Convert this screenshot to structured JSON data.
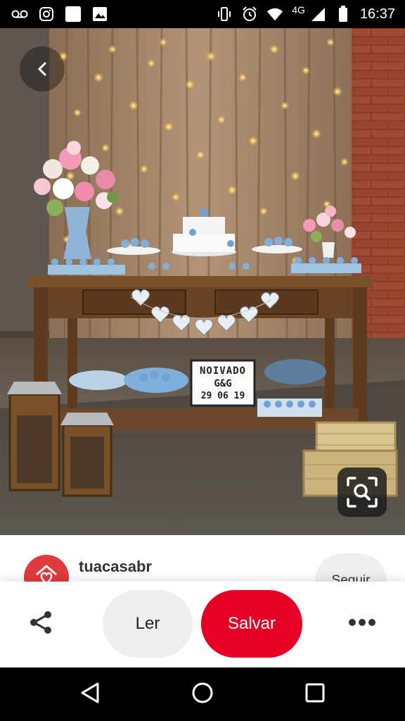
{
  "status_bar": {
    "time": "16:37",
    "network": "4G",
    "icons": [
      "voicemail-icon",
      "instagram-icon",
      "app-square-icon",
      "gallery-icon",
      "vibrate-icon",
      "alarm-icon",
      "wifi-icon",
      "signal-icon",
      "battery-icon"
    ]
  },
  "pin": {
    "lightbox_sign": {
      "line1": "NOIVADO",
      "line2": "G&G",
      "line3": "29 06 19"
    }
  },
  "profile": {
    "username": "tuacasabr",
    "follow_label": "Seguir"
  },
  "actions": {
    "read_label": "Ler",
    "save_label": "Salvar"
  },
  "colors": {
    "save_button": "#e60023",
    "avatar": "#e0393e"
  }
}
